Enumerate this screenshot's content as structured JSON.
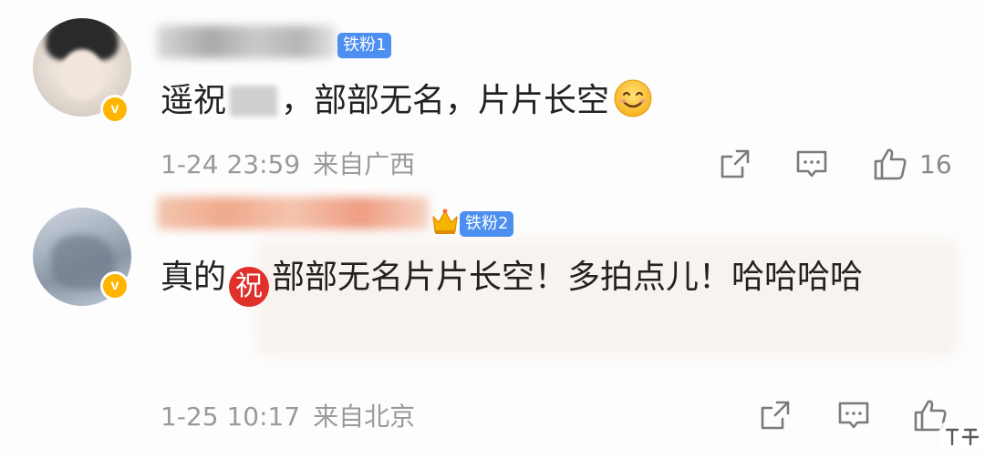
{
  "comments": [
    {
      "fan_badge": "铁粉1",
      "content_before": "遥祝",
      "content_after": "，部部无名，片片长空",
      "timestamp": "1-24 23:59",
      "location": "来自广西",
      "likes": "16",
      "icons": [
        "v-badge-icon",
        "smile-emoji-icon",
        "share-icon",
        "comment-icon",
        "like-icon"
      ]
    },
    {
      "fan_badge": "铁粉2",
      "content_before": "真的",
      "zhu_glyph": "祝",
      "content_after": "部部无名片片长空！多拍点儿！哈哈哈哈",
      "timestamp": "1-25 10:17",
      "location": "来自北京",
      "icons": [
        "v-badge-icon",
        "crown-icon",
        "zhu-emoji-icon",
        "share-icon",
        "comment-icon",
        "like-icon"
      ]
    }
  ],
  "colors": {
    "fan_badge": "#4c8ff0",
    "verified_badge": "#ffb400",
    "zhu_emoji": "#e0302c",
    "meta_text": "#9a9a9a",
    "content_text": "#222222"
  }
}
